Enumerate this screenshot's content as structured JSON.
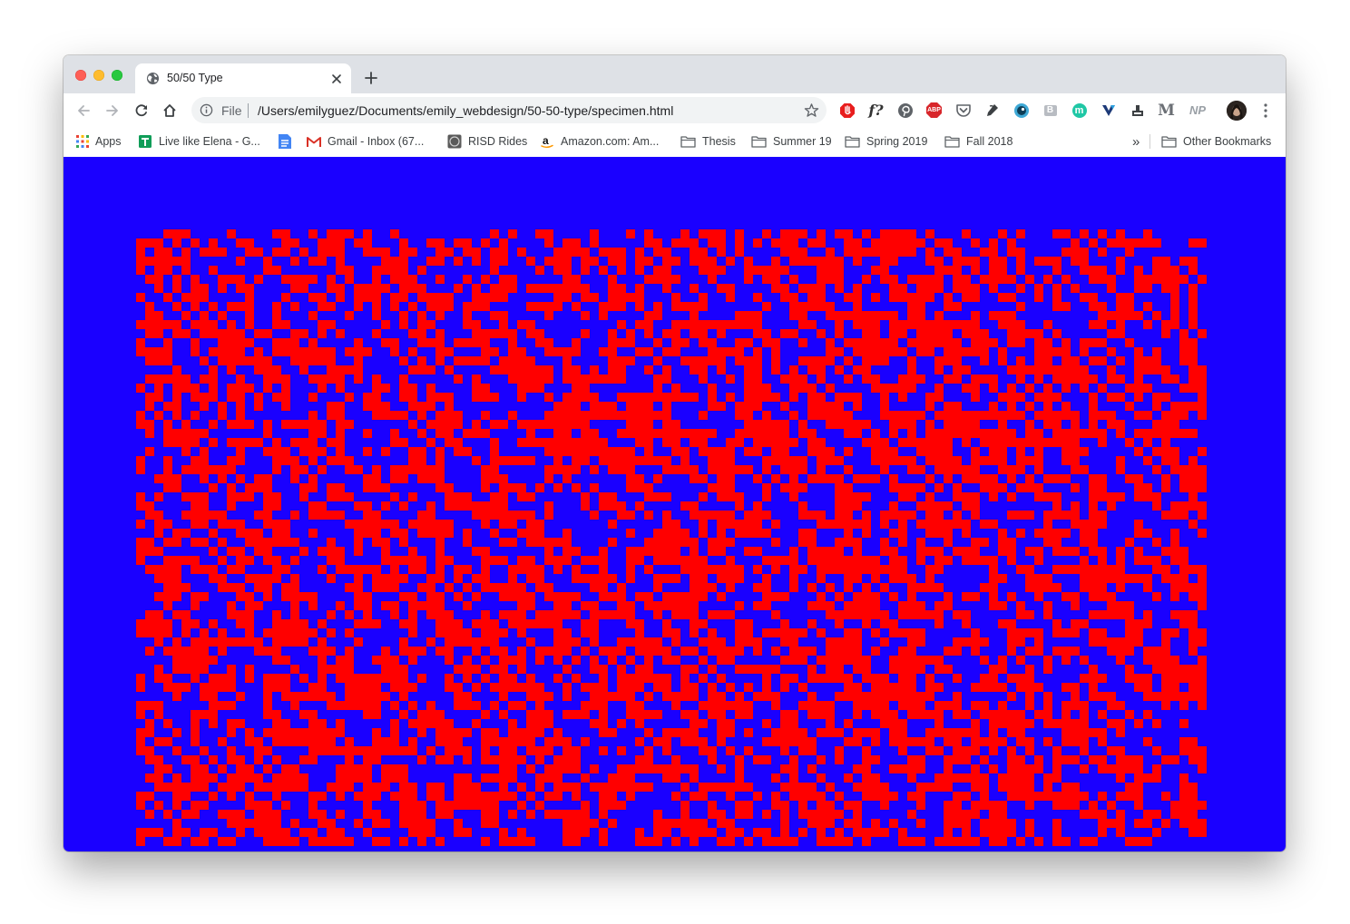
{
  "browser": {
    "tab_title": "50/50 Type",
    "address": {
      "scheme_label": "File",
      "url": "/Users/emilyguez/Documents/emily_webdesign/50-50-type/specimen.html"
    },
    "extensions": [
      "adblock-icon",
      "font-identifier-icon",
      "pinterest-icon",
      "abp-icon",
      "pocket-icon",
      "pen-icon",
      "eye-icon",
      "b-icon",
      "m-icon",
      "v-icon",
      "stamp-icon",
      "medium-icon",
      "np-icon"
    ],
    "extension_labels": {
      "abp": "ABP",
      "f": "f?",
      "medium": "M",
      "np": "NP",
      "m": "m",
      "b": "B"
    }
  },
  "bookmarks": {
    "items": [
      {
        "label": "Apps",
        "icon": "apps-grid-icon"
      },
      {
        "label": "Live like Elena - G...",
        "icon": "sheets-icon"
      },
      {
        "label": "",
        "icon": "docs-icon"
      },
      {
        "label": "Gmail - Inbox (67...",
        "icon": "gmail-icon"
      },
      {
        "label": "RISD Rides",
        "icon": "risd-icon"
      },
      {
        "label": "Amazon.com: Am...",
        "icon": "amazon-icon"
      },
      {
        "label": "Thesis",
        "icon": "folder-icon"
      },
      {
        "label": "Summer 19",
        "icon": "folder-icon"
      },
      {
        "label": "Spring 2019",
        "icon": "folder-icon"
      },
      {
        "label": "Fall 2018",
        "icon": "folder-icon"
      }
    ],
    "overflow": "»",
    "other": "Other Bookmarks"
  },
  "page": {
    "background_color": "#1a00ff",
    "cell_color": "#ff0000",
    "grid_columns": 118,
    "grid_rows_visible": 68,
    "fill_ratio": 0.5
  }
}
